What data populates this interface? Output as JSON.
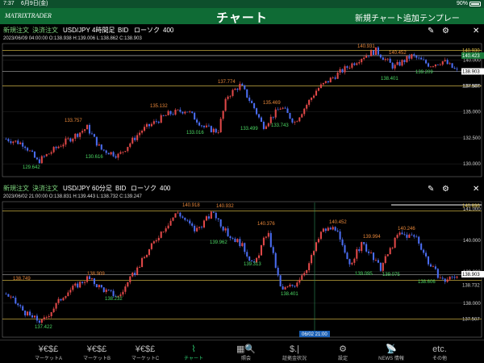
{
  "status": {
    "time": "7:37",
    "date": "6月9日(金)",
    "battery": "90%"
  },
  "header": {
    "logo": "MATRIXTRADER",
    "title": "チャート",
    "add_chart": "新規チャート追加",
    "template": "テンプレー"
  },
  "chart1": {
    "buy": "新規注文",
    "settle": "決済注文",
    "pair": "USD/JPY",
    "timeframe": "4時間足",
    "side": "BID",
    "type": "ローソク",
    "count": "400",
    "info": "2023/06/09 04:00:00   O:138.938   H:139.006   L:138.862   C:138.903",
    "y_labels": [
      "140.000",
      "137.500",
      "135.000",
      "132.500",
      "130.000"
    ],
    "badges": {
      "ask": "140.423",
      "price": "138.903",
      "low": "137.507",
      "high": "140.930"
    },
    "annotations": [
      {
        "text": "140.931",
        "color": "#e8873a"
      },
      {
        "text": "140.452",
        "color": "#e8873a"
      },
      {
        "text": "139.209",
        "color": "#4cd964"
      },
      {
        "text": "138.401",
        "color": "#4cd964"
      },
      {
        "text": "137.774",
        "color": "#e8873a"
      },
      {
        "text": "135.469",
        "color": "#e8873a"
      },
      {
        "text": "135.132",
        "color": "#e8873a"
      },
      {
        "text": "133.757",
        "color": "#e8873a"
      },
      {
        "text": "133.499",
        "color": "#4cd964"
      },
      {
        "text": "133.743",
        "color": "#4cd964"
      },
      {
        "text": "133.016",
        "color": "#4cd964"
      },
      {
        "text": "130.616",
        "color": "#4cd964"
      },
      {
        "text": "129.642",
        "color": "#4cd964"
      }
    ]
  },
  "chart2": {
    "buy": "新規注文",
    "settle": "決済注文",
    "pair": "USD/JPY",
    "timeframe": "60分足",
    "side": "BID",
    "type": "ローソク",
    "count": "400",
    "info": "2023/06/02 21:00:00   O:138.831   H:139.443   L:138.732   C:139.247",
    "y_labels": [
      "141.000",
      "140.000",
      "139.000",
      "138.000"
    ],
    "badges": {
      "top": "140.896",
      "price": "138.903",
      "mid": "138.732",
      "low": "137.507"
    },
    "cursor_label": "06/02 21:00",
    "annotations": [
      {
        "text": "140.918",
        "color": "#e8873a"
      },
      {
        "text": "140.932",
        "color": "#e8873a"
      },
      {
        "text": "140.376",
        "color": "#e8873a"
      },
      {
        "text": "140.452",
        "color": "#e8873a"
      },
      {
        "text": "140.246",
        "color": "#e8873a"
      },
      {
        "text": "139.994",
        "color": "#e8873a"
      },
      {
        "text": "139.962",
        "color": "#4cd964"
      },
      {
        "text": "139.313",
        "color": "#4cd964"
      },
      {
        "text": "139.095",
        "color": "#4cd964"
      },
      {
        "text": "139.075",
        "color": "#4cd964"
      },
      {
        "text": "138.909",
        "color": "#e8873a"
      },
      {
        "text": "138.749",
        "color": "#e8873a"
      },
      {
        "text": "138.401",
        "color": "#4cd964"
      },
      {
        "text": "138.232",
        "color": "#4cd964"
      },
      {
        "text": "138.606",
        "color": "#4cd964"
      },
      {
        "text": "137.422",
        "color": "#4cd964"
      }
    ]
  },
  "nav": [
    {
      "icon": "¥€$£",
      "label": "マーケットA",
      "active": false
    },
    {
      "icon": "¥€$£",
      "label": "マーケットB",
      "active": false
    },
    {
      "icon": "¥€$£",
      "label": "マーケットC",
      "active": false
    },
    {
      "icon": "⌇",
      "label": "チャート",
      "active": true
    },
    {
      "icon": "▦🔍",
      "label": "照会",
      "active": false
    },
    {
      "icon": "$.|",
      "label": "証拠金状況",
      "active": false
    },
    {
      "icon": "⚙",
      "label": "設定",
      "active": false
    },
    {
      "icon": "📡",
      "label": "NEWS 情報",
      "active": false
    },
    {
      "icon": "etc.",
      "label": "その他",
      "active": false
    }
  ],
  "colors": {
    "up": "#e04848",
    "down": "#4a6cf0",
    "header": "#0f6b35",
    "active": "#2ecc71"
  }
}
